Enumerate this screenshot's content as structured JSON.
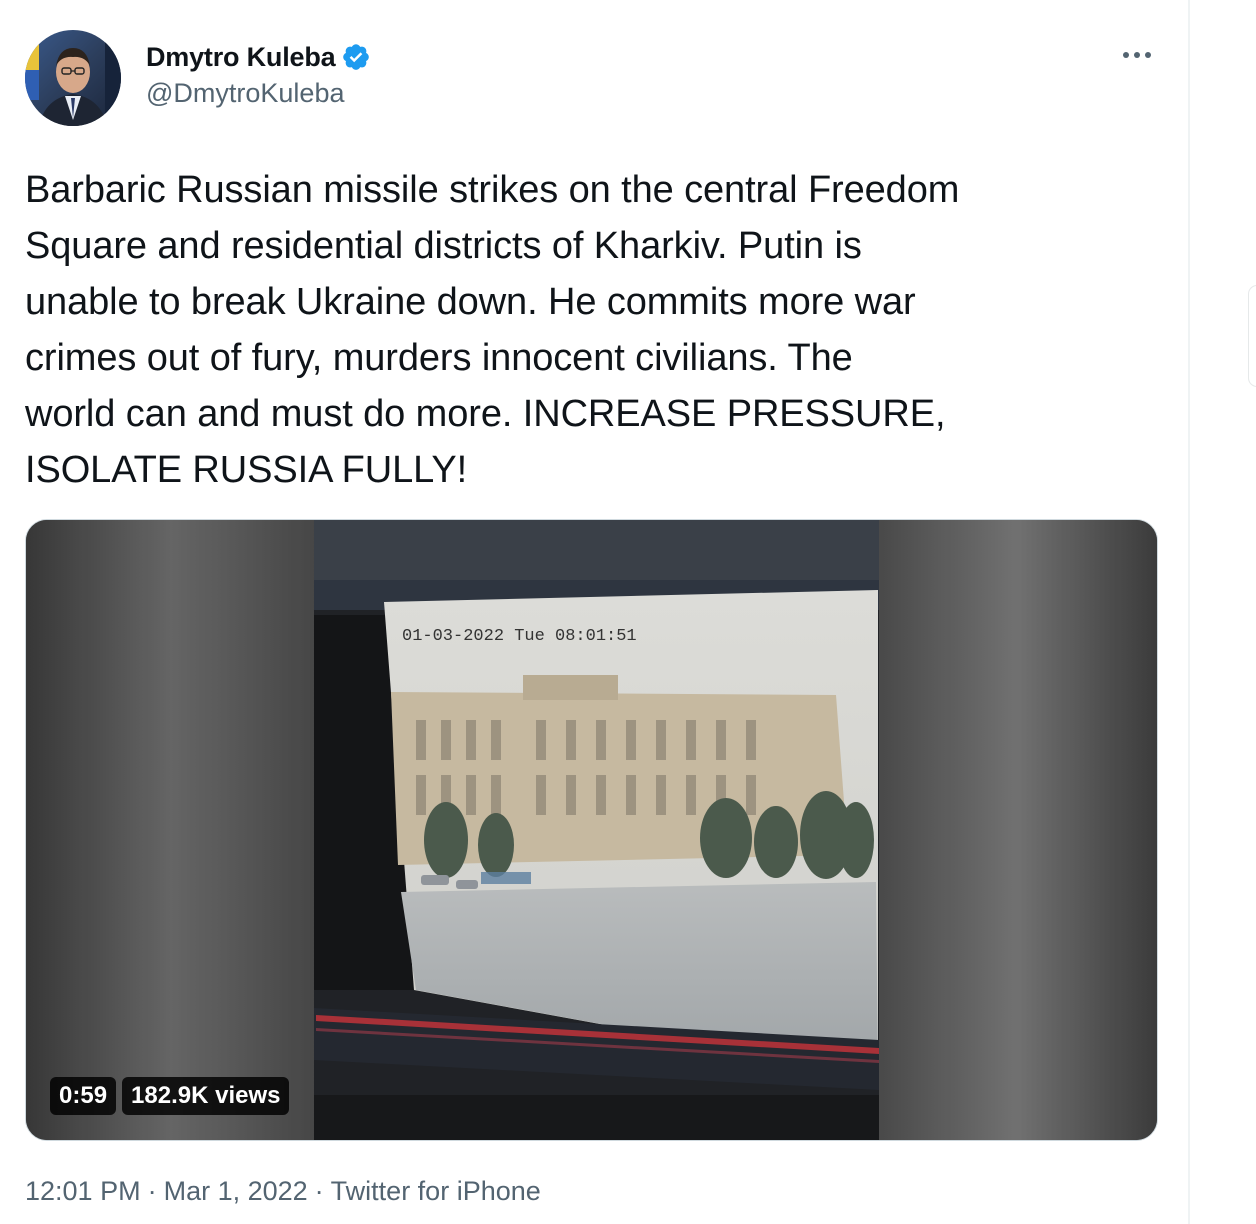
{
  "author": {
    "display_name": "Dmytro Kuleba",
    "handle": "@DmytroKuleba",
    "verified": true
  },
  "tweet": {
    "text": "Barbaric Russian missile strikes on the central Freedom\nSquare and residential districts of Kharkiv. Putin is\nunable to break Ukraine down. He commits more war\ncrimes out of fury, murders innocent civilians. The\nworld can and must do more. INCREASE PRESSURE,\nISOLATE RUSSIA FULLY!"
  },
  "media": {
    "overlay_timestamp": "01-03-2022 Tue 08:01:51",
    "duration": "0:59",
    "views": "182.9K views"
  },
  "meta": {
    "time": "12:01 PM",
    "separator": "·",
    "date": "Mar 1, 2022",
    "source": "Twitter for iPhone"
  },
  "colors": {
    "verified_blue": "#1d9bf0",
    "secondary_text": "#536471",
    "primary_text": "#0f1419"
  },
  "icons": {
    "verified": "verified-badge-icon",
    "more": "more-options-icon"
  }
}
